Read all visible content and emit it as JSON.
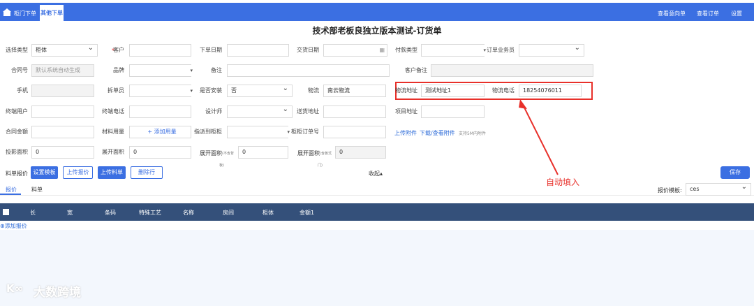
{
  "nav": {
    "tabs": [
      "柜门下单",
      "其他下单"
    ],
    "right": [
      "查看意向单",
      "查看订单",
      "设置"
    ]
  },
  "title": "技术部老板良独立版本测试-订货单",
  "form": {
    "type_label": "选择类型",
    "type_value": "柜体",
    "customer_label": "客户",
    "customer_required": "*",
    "order_date_label": "下单日期",
    "delivery_date_label": "交货日期",
    "payment_label": "付款类型",
    "salesman_label": "订单业务员",
    "contract_no_label": "合同号",
    "contract_no_placeholder": "默认系统自动生成",
    "brand_label": "品牌",
    "remark_label": "备注",
    "customer_remark_label": "客户备注",
    "phone_label": "手机",
    "splitter_label": "拆单员",
    "install_label": "是否安装",
    "install_value": "否",
    "logistics_label": "物流",
    "logistics_value": "南云物流",
    "logistics_addr_label": "物流地址",
    "logistics_addr_value": "测试地址1",
    "logistics_phone_label": "物流电话",
    "logistics_phone_value": "18254076011",
    "end_user_label": "终端用户",
    "end_phone_label": "终端电话",
    "designer_label": "设计师",
    "ship_addr_label": "送货地址",
    "project_addr_label": "项目地址",
    "contract_amount_label": "合同金额",
    "material_label": "材料用量",
    "add_material": "+ 添加用量",
    "assign_label": "指派到柜柜",
    "cabinet_order_label": "柜柜订单号",
    "upload_attach": "上传附件",
    "download_attach": "下载/查看附件",
    "attach_hint": "支持5M内附件",
    "proj_area_label": "投影面积",
    "proj_area_value": "0",
    "unfold_area_label": "展开面积",
    "unfold_area_value": "0",
    "unfold_nb_label": "展开面积",
    "unfold_nb_note": "(不含背",
    "unfold_nb_note2": "板)",
    "unfold_nb_value": "0",
    "unfold_door_label": "展开面积",
    "unfold_door_note": "(含板式",
    "unfold_door_note2": "门)",
    "unfold_door_value": "0"
  },
  "actions": {
    "label": "料单报价",
    "set_template": "设置模板",
    "upload_quote": "上传报价",
    "upload_bom": "上传料单",
    "delete_row": "删除行",
    "collapse": "收起▴",
    "save": "保存"
  },
  "annotation": "自动填入",
  "tabs": [
    "报价",
    "料单"
  ],
  "template_label": "报价模板:",
  "template_value": "ces",
  "table": {
    "columns": [
      "长",
      "宽",
      "条码",
      "特殊工艺",
      "名称",
      "房间",
      "柜体",
      "金额1"
    ],
    "add_row": "添加报价"
  },
  "watermark": "大数跨境",
  "colors": {
    "primary": "#3b6fe2",
    "header": "#34507a",
    "annotation": "#e8302a"
  }
}
